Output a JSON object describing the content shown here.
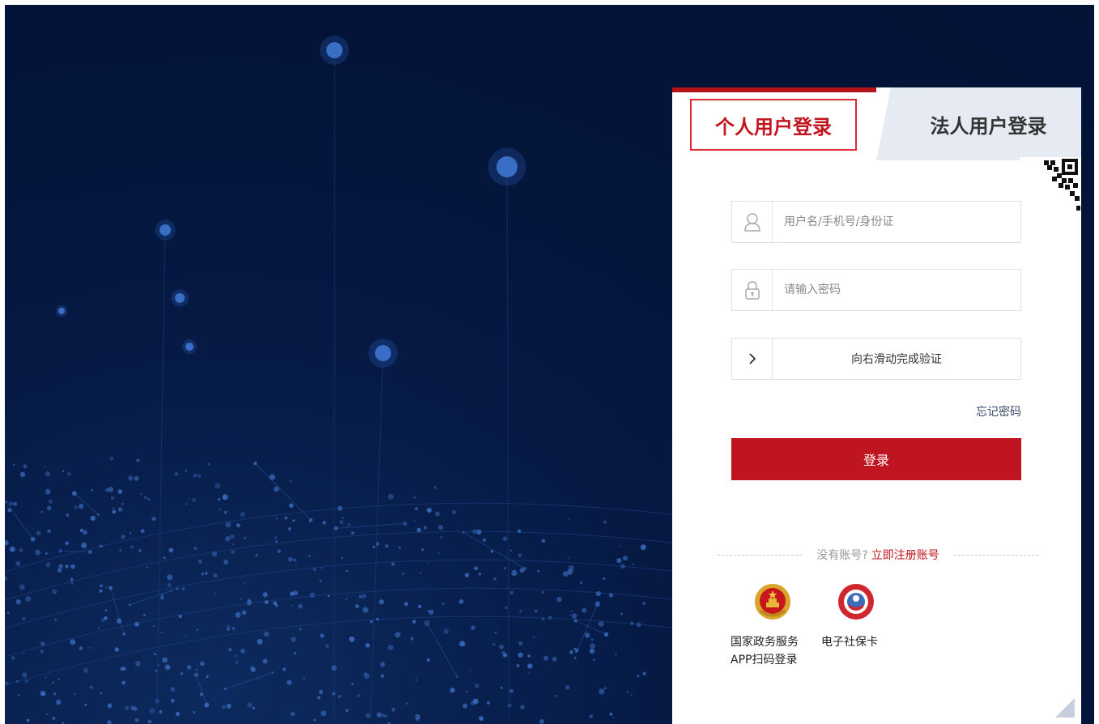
{
  "tabs": {
    "personal": "个人用户登录",
    "legal": "法人用户登录"
  },
  "form": {
    "username_placeholder": "用户名/手机号/身份证",
    "password_placeholder": "请输入密码",
    "slider_text": "向右滑动完成验证",
    "forgot_password": "忘记密码",
    "login_button": "登录"
  },
  "register": {
    "question": "没有账号?",
    "link": "立即注册账号"
  },
  "alt_logins": {
    "gov_app": {
      "line1": "国家政务服务",
      "line2": "APP扫码登录"
    },
    "social_card": "电子社保卡"
  },
  "colors": {
    "accent": "#be1520",
    "background": "#04153a"
  }
}
